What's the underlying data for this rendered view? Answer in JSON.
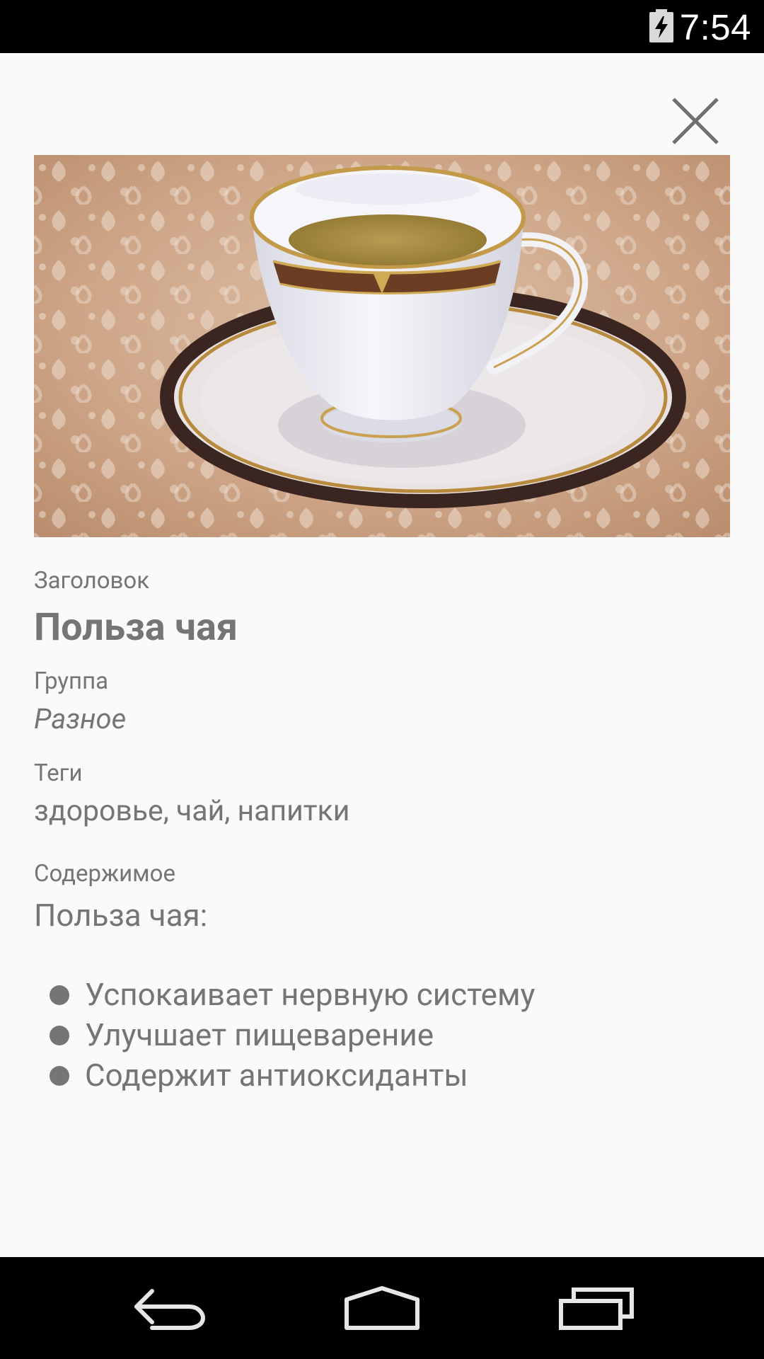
{
  "status_bar": {
    "time": "7:54",
    "battery_icon": "battery-charging-icon"
  },
  "toolbar": {
    "close_icon": "close-icon"
  },
  "note": {
    "image": {
      "description_icon": "photo-teacup-image"
    },
    "title_label": "Заголовок",
    "title": "Польза чая",
    "group_label": "Группа",
    "group": "Разное",
    "tags_label": "Теги",
    "tags": "здоровье, чай, напитки",
    "content_label": "Содержимое",
    "content_intro": "Польза чая:",
    "content_items": [
      "Успокаивает нервную систему",
      "Улучшает пищеварение",
      "Содержит антиоксиданты"
    ]
  },
  "nav_bar": {
    "back_icon": "back-icon",
    "home_icon": "home-icon",
    "recents_icon": "recents-icon"
  },
  "colors": {
    "background": "#fafafa",
    "text": "#757575",
    "system_bars": "#000000"
  }
}
